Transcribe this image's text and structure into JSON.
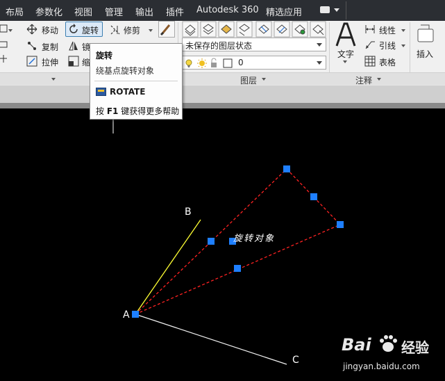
{
  "menu": {
    "items": [
      "布局",
      "参数化",
      "视图",
      "管理",
      "输出",
      "插件",
      "Autodesk 360",
      "精选应用"
    ]
  },
  "ribbon": {
    "modify": {
      "move": "移动",
      "rotate": "旋转",
      "trim": "修剪",
      "copy": "复制",
      "mirror": "镜",
      "stretch": "拉伸",
      "scale": "缩"
    },
    "layers": {
      "state_dropdown": "未保存的图层状态",
      "layer_dropdown": "0",
      "panel_title": "图层"
    },
    "annotation": {
      "text": "文字",
      "linear": "线性",
      "leader": "引线",
      "table": "表格",
      "panel_title": "注释"
    },
    "block": {
      "insert": "插入"
    }
  },
  "tooltip": {
    "title": "旋转",
    "description": "绕基点旋转对象",
    "command": "ROTATE",
    "help_prefix": "按 ",
    "help_key": "F1",
    "help_suffix": " 键获得更多帮助"
  },
  "drawing": {
    "label_a": "A",
    "label_b": "B",
    "label_c": "C",
    "rotated_text": "旋转对象",
    "colors": {
      "dashed_object": "#ff2222",
      "line_ab": "#ffff33",
      "line_ac": "#ffffff",
      "grip": "#1e7fff"
    }
  },
  "watermark": {
    "brand": "Bai",
    "brand_suffix": "经验",
    "url": "jingyan.baidu.com"
  }
}
